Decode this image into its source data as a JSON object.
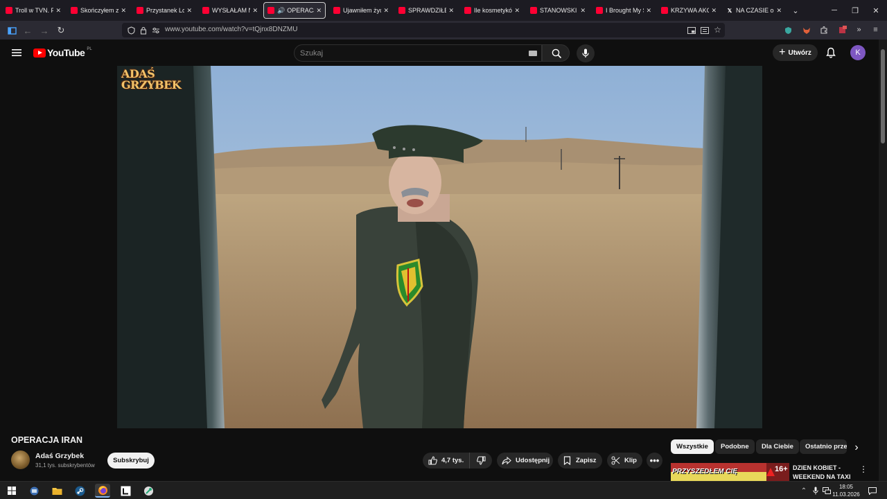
{
  "browser": {
    "tabs": [
      {
        "label": "Troll w TVN. Po"
      },
      {
        "label": "Skończyłem zwi"
      },
      {
        "label": "Przystanek Lom"
      },
      {
        "label": "WYSŁAŁAM NA"
      },
      {
        "label": "OPERACJA I",
        "active": true,
        "audio": true
      },
      {
        "label": "Ujawniłem żydo"
      },
      {
        "label": "SPRAWDZIŁEM"
      },
      {
        "label": "Ile kosmetyków"
      },
      {
        "label": "STANOWSKI UJ"
      },
      {
        "label": "I Brought My Se"
      },
      {
        "label": "KRZYWA AKCJA"
      },
      {
        "label": "NA CZASIE on X",
        "favicon": "x-icon"
      }
    ],
    "url": "www.youtube.com/watch?v=tQjnx8DNZMU"
  },
  "youtube": {
    "logo_text": "YouTube",
    "country_code": "PL",
    "search_placeholder": "Szukaj",
    "create_label": "Utwórz",
    "avatar_letter": "K"
  },
  "video": {
    "title": "OPERACJA IRAN",
    "watermark_line1": "ADAŚ",
    "watermark_line2": "GRZYBEK",
    "channel_name": "Adaś Grzybek",
    "subscribers": "31,1 tys. subskrybentów",
    "subscribe_label": "Subskrybuj",
    "likes": "4,7 tys.",
    "share_label": "Udostępnij",
    "save_label": "Zapisz",
    "clip_label": "Klip"
  },
  "recommendations": {
    "chips": [
      "Wszystkie",
      "Podobne",
      "Dla Ciebie",
      "Ostatnio prze"
    ],
    "selected_chip": "Wszystkie",
    "first_video_title": "DZIEN KOBIET - WEEKEND NA TAXI",
    "first_video_thumb_text": "PRZYSZEDŁEM CIĘ",
    "first_video_thumb_badge": "16+"
  },
  "taskbar": {
    "time": "18:05",
    "date": "11.03.2026"
  },
  "colors": {
    "youtube_red": "#ff0000",
    "background": "#0f0f0f",
    "avatar": "#7e57c2"
  }
}
